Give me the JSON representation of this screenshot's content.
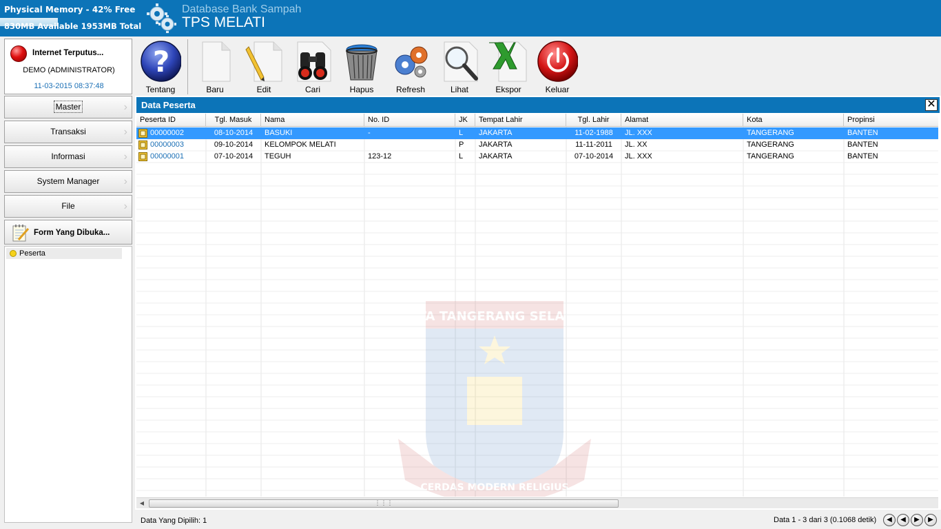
{
  "header": {
    "memory_line1": "Physical Memory - 42% Free",
    "memory_line2": "830MB Available  1953MB Total",
    "app_subtitle": "Database Bank Sampah",
    "app_title": "TPS MELATI"
  },
  "sidebar": {
    "connection_status": "Internet Terputus...",
    "user": "DEMO (ADMINISTRATOR)",
    "datetime": "11-03-2015 08:37:48",
    "menu": [
      {
        "label": "Master"
      },
      {
        "label": "Transaksi"
      },
      {
        "label": "Informasi"
      },
      {
        "label": "System Manager"
      },
      {
        "label": "File"
      }
    ],
    "forms_header": "Form Yang Dibuka...",
    "open_forms": [
      {
        "label": "Peserta"
      }
    ]
  },
  "toolbar": {
    "buttons": [
      {
        "label": "Tentang",
        "icon": "help-icon"
      },
      {
        "label": "Baru",
        "icon": "new-document-icon"
      },
      {
        "label": "Edit",
        "icon": "edit-pencil-icon"
      },
      {
        "label": "Cari",
        "icon": "binoculars-icon"
      },
      {
        "label": "Hapus",
        "icon": "trash-bin-icon"
      },
      {
        "label": "Refresh",
        "icon": "refresh-gears-icon"
      },
      {
        "label": "Lihat",
        "icon": "magnifier-icon"
      },
      {
        "label": "Ekspor",
        "icon": "excel-export-icon"
      },
      {
        "label": "Keluar",
        "icon": "power-off-icon"
      }
    ]
  },
  "panel": {
    "title": "Data Peserta",
    "columns": [
      "Peserta ID",
      "Tgl. Masuk",
      "Nama",
      "No. ID",
      "JK",
      "Tempat Lahir",
      "Tgl. Lahir",
      "Alamat",
      "Kota",
      "Propinsi"
    ],
    "rows": [
      {
        "selected": true,
        "cells": [
          "00000002",
          "08-10-2014",
          "BASUKI",
          "-",
          "L",
          "JAKARTA",
          "11-02-1988",
          "JL. XXX",
          "TANGERANG",
          "BANTEN"
        ]
      },
      {
        "selected": false,
        "cells": [
          "00000003",
          "09-10-2014",
          "KELOMPOK MELATI",
          "",
          "P",
          "JAKARTA",
          "11-11-2011",
          "JL. XX",
          "TANGERANG",
          "BANTEN"
        ]
      },
      {
        "selected": false,
        "cells": [
          "00000001",
          "07-10-2014",
          "TEGUH",
          "123-12",
          "L",
          "JAKARTA",
          "07-10-2014",
          "JL. XXX",
          "TANGERANG",
          "BANTEN"
        ]
      }
    ],
    "watermark_top": "KOTA TANGERANG SELATAN",
    "watermark_bottom": "CERDAS MODERN RELIGIUS"
  },
  "status": {
    "selected_text": "Data Yang Dipilih: 1",
    "paging_text": "Data 1 - 3 dari 3 (0.1068 detik)"
  },
  "colors": {
    "accent": "#0c74b8",
    "selection": "#3399ff",
    "link": "#1a6fb5"
  }
}
